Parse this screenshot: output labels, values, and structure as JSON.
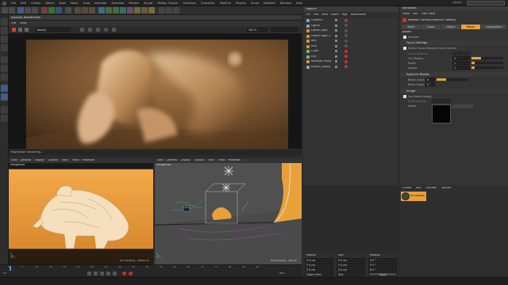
{
  "menubar": {
    "items": [
      "File",
      "Edit",
      "Create",
      "Select",
      "Tools",
      "Mesh",
      "Snap",
      "Animate",
      "Simulate",
      "Render",
      "Sculpt",
      "Motion Tracker",
      "MoGraph",
      "Character",
      "Pipeline",
      "Plugins",
      "Script",
      "Redshift",
      "Window",
      "Help"
    ],
    "layout_label": "Layout:"
  },
  "render_view": {
    "title": "Redshift RenderView",
    "menu": [
      "File",
      "View"
    ],
    "camera_select": "Beauty",
    "zoom": "100 %",
    "status": "Progressive Rendering..."
  },
  "viewport_left": {
    "menu": [
      "View",
      "Cameras",
      "Display",
      "Options",
      "Filter",
      "Panel",
      "ProRender"
    ],
    "label": "Perspective",
    "grid_spacing": "Grid Spacing : 10000 cm"
  },
  "viewport_right": {
    "menu": [
      "View",
      "Cameras",
      "Display",
      "Options",
      "Filter",
      "Panel",
      "ProRender"
    ],
    "label": "Perspective",
    "grid_spacing": "Grid Spacing : 100 cm"
  },
  "object_manager": {
    "menu": [
      "File",
      "Edit",
      "View",
      "Object",
      "Tags",
      "Bookmarks"
    ],
    "title": "Objects",
    "objects": [
      {
        "name": "Camera",
        "color": "#7fa6d6"
      },
      {
        "name": "Lights",
        "color": "#9aa0a6"
      },
      {
        "name": "Dome Light",
        "color": "#d4953a"
      },
      {
        "name": "Dome Light.1",
        "color": "#d4953a"
      },
      {
        "name": "Key",
        "color": "#d4953a"
      },
      {
        "name": "Rim",
        "color": "#d4953a"
      },
      {
        "name": "Cube",
        "color": "#7fb36a"
      },
      {
        "name": "Eye",
        "color": "#9aa0a6"
      },
      {
        "name": "Redshift Proxy",
        "color": "#d4953a"
      },
      {
        "name": "Bullsh_Statue",
        "color": "#9aa0a6"
      }
    ]
  },
  "attributes": {
    "title": "Attributes",
    "menu": [
      "Mode",
      "Edit",
      "User Data"
    ],
    "object_title": "Redshift Camera [Redshift Camera]",
    "tabs": [
      "Basic",
      "Coord.",
      "Object",
      "Bokeh",
      "Composition"
    ],
    "active_tab": "Bokeh",
    "section_title": "Bokeh",
    "enabled_label": "Enabled",
    "section_focus": "Focus Settings",
    "derive_label": "Derive Focus Distance from Camera",
    "focus_distance_label": "Focus Distance",
    "coc_label": "CoC Radius",
    "power_label": "Power",
    "aspect_label": "Aspect",
    "coc_value": "3",
    "power_value": "1",
    "aspect_value": "1",
    "section_aperture": "Aperture Blades",
    "blade_count_label": "Blade Count",
    "blade_angle_label": "Blade Angle",
    "blade_count_value": "6",
    "blade_angle_value": "0 °",
    "section_image": "Image",
    "use_bokeh_label": "Use Bokeh Image",
    "normalization_label": "Normalization",
    "image_label": "Image"
  },
  "material_manager": {
    "menu": [
      "Create",
      "Edit",
      "Function",
      "Texture"
    ],
    "material_name": "RS Material"
  },
  "coordinates": {
    "headers": [
      "Position",
      "Size",
      "Rotation"
    ],
    "rows": [
      {
        "pos": "X 0 cm",
        "size": "X 0 cm",
        "rot": "H 0 °"
      },
      {
        "pos": "Y 0 cm",
        "size": "Y 0 cm",
        "rot": "P 0 °"
      },
      {
        "pos": "Z 0 cm",
        "size": "Z 0 cm",
        "rot": "B 0 °"
      }
    ],
    "mode": "Object (Rel)",
    "size_mode": "Size",
    "apply": "Apply"
  },
  "timeline": {
    "ticks": [
      "0",
      "5",
      "10",
      "15",
      "20",
      "25",
      "30",
      "35",
      "40",
      "45",
      "50",
      "55",
      "60",
      "65",
      "70",
      "75",
      "80",
      "85",
      "90"
    ],
    "current_frame": "0 F",
    "end_frame": "90 F"
  },
  "colors": {
    "accent_orange": "#e8a13a",
    "viewport_bg": "#505050",
    "render_bg": "#161616"
  }
}
